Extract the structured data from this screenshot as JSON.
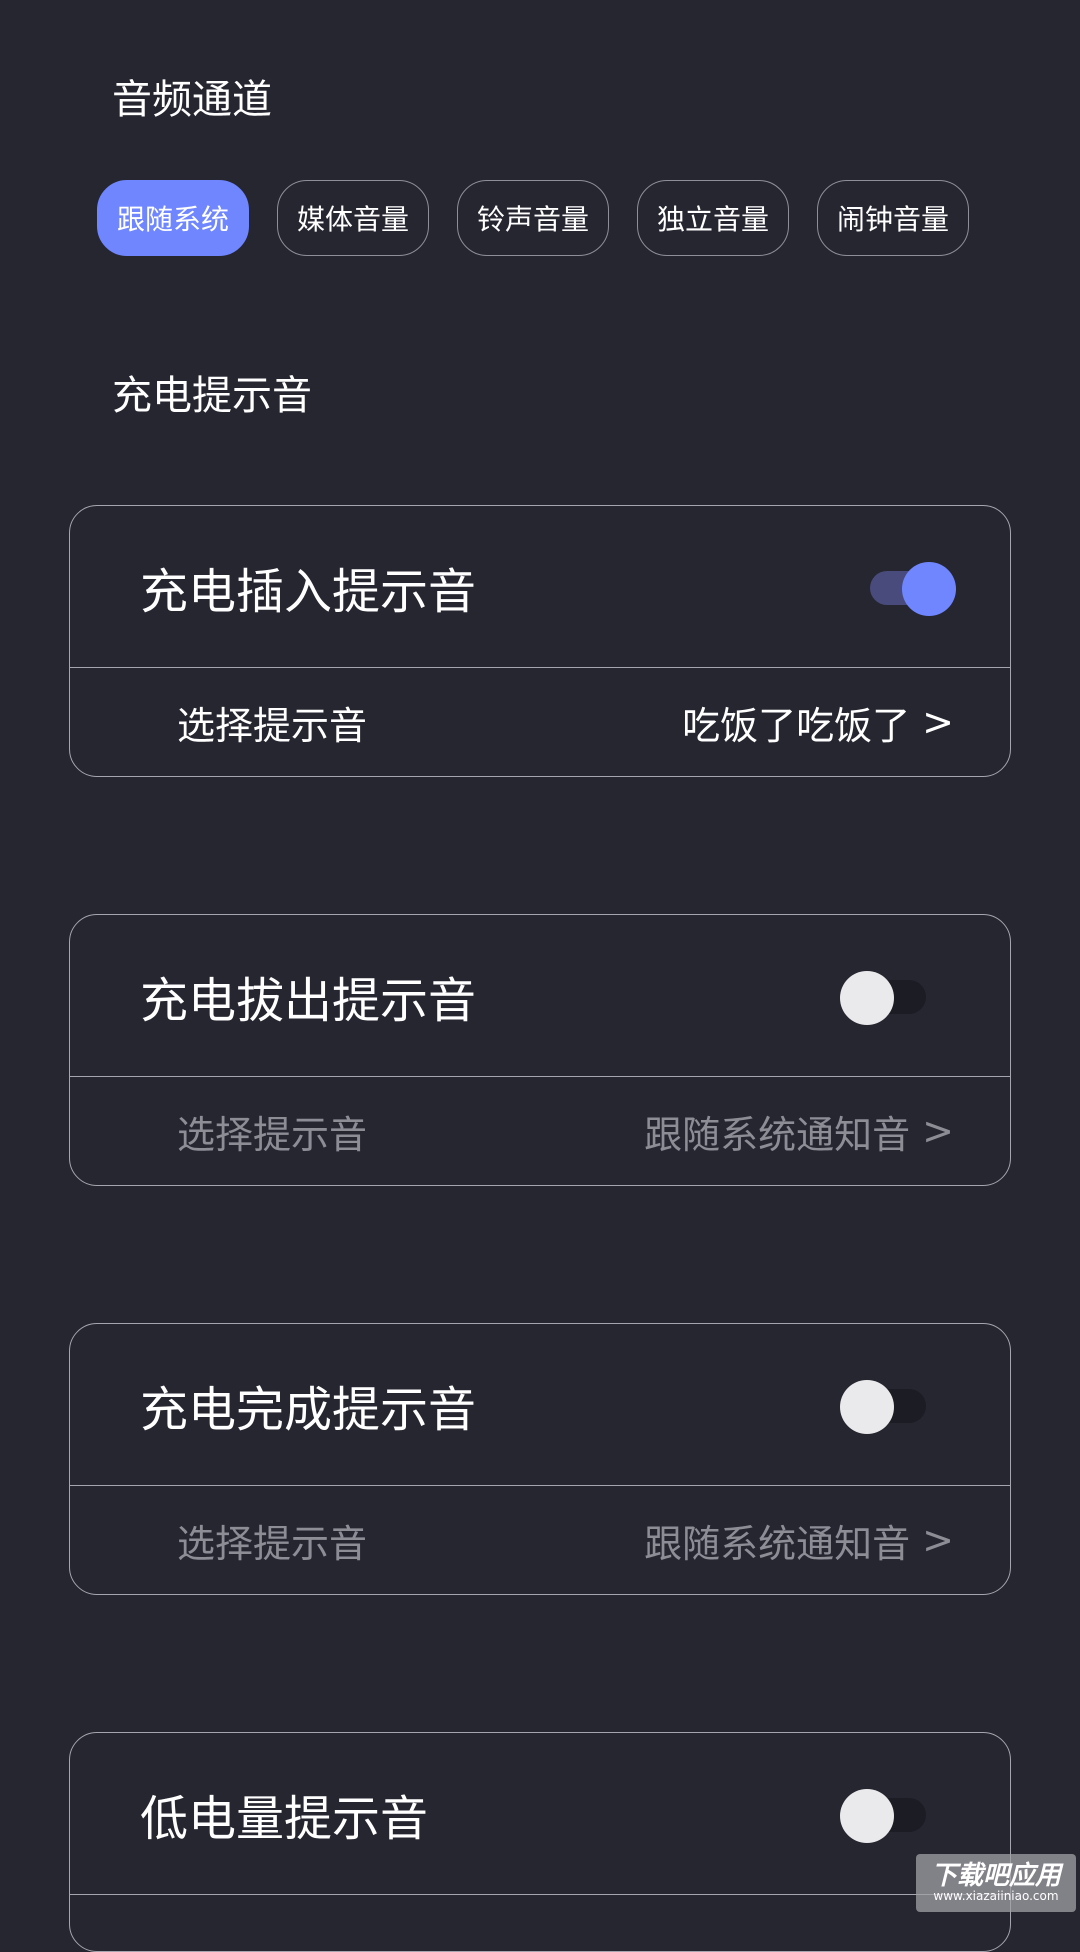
{
  "audio_channel": {
    "title": "音频通道",
    "chips": [
      {
        "label": "跟随系统",
        "active": true
      },
      {
        "label": "媒体音量",
        "active": false
      },
      {
        "label": "铃声音量",
        "active": false
      },
      {
        "label": "独立音量",
        "active": false
      },
      {
        "label": "闹钟音量",
        "active": false
      }
    ]
  },
  "charge_tones": {
    "title": "充电提示音",
    "cards": [
      {
        "title": "充电插入提示音",
        "enabled": true,
        "row_label": "选择提示音",
        "row_value": "吃饭了吃饭了",
        "chevron": ">"
      },
      {
        "title": "充电拔出提示音",
        "enabled": false,
        "row_label": "选择提示音",
        "row_value": "跟随系统通知音",
        "chevron": ">"
      },
      {
        "title": "充电完成提示音",
        "enabled": false,
        "row_label": "选择提示音",
        "row_value": "跟随系统通知音",
        "chevron": ">"
      },
      {
        "title": "低电量提示音",
        "enabled": false
      }
    ]
  },
  "watermark": {
    "main": "下载吧应用",
    "sub": "www.xiazaiiniao.com"
  },
  "colors": {
    "background": "#262631",
    "accent": "#6f86ff",
    "text_primary": "#ffffff",
    "text_disabled": "#8d8d96",
    "border": "#a5a5ad"
  }
}
